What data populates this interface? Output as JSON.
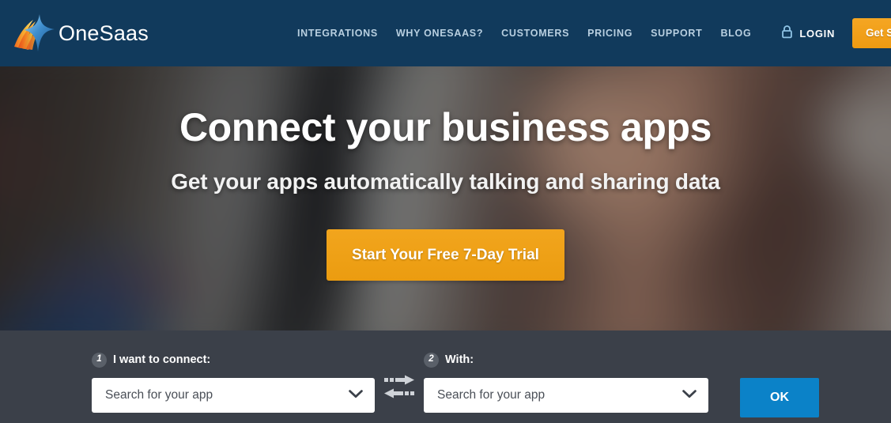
{
  "header": {
    "brand": {
      "name": "OneSaas",
      "logo_icon": "onesaas-star-logo"
    },
    "nav_items": [
      {
        "label": "INTEGRATIONS"
      },
      {
        "label": "WHY ONESAAS?"
      },
      {
        "label": "CUSTOMERS"
      },
      {
        "label": "PRICING"
      },
      {
        "label": "SUPPORT"
      },
      {
        "label": "BLOG"
      }
    ],
    "login": {
      "label": "LOGIN",
      "icon": "lock-icon"
    },
    "get_started_label": "Get Started",
    "colors": {
      "background": "#113a5c",
      "nav_link": "#b8cfe0",
      "accent_orange": "#f2a51d"
    }
  },
  "hero": {
    "title": "Connect your business apps",
    "subtitle": "Get your apps automatically talking and sharing data",
    "cta_label": "Start Your Free 7-Day Trial"
  },
  "connect_bar": {
    "background": "#3b4049",
    "step_one": {
      "number": "1",
      "label": "I want to connect:",
      "select_value": "Search for your app",
      "chevron_icon": "chevron-down-icon"
    },
    "swap_icon": "exchange-arrows-icon",
    "step_two": {
      "number": "2",
      "label": "With:",
      "select_value": "Search for your app",
      "chevron_icon": "chevron-down-icon"
    },
    "ok_label": "OK",
    "ok_color": "#0b82c8"
  }
}
